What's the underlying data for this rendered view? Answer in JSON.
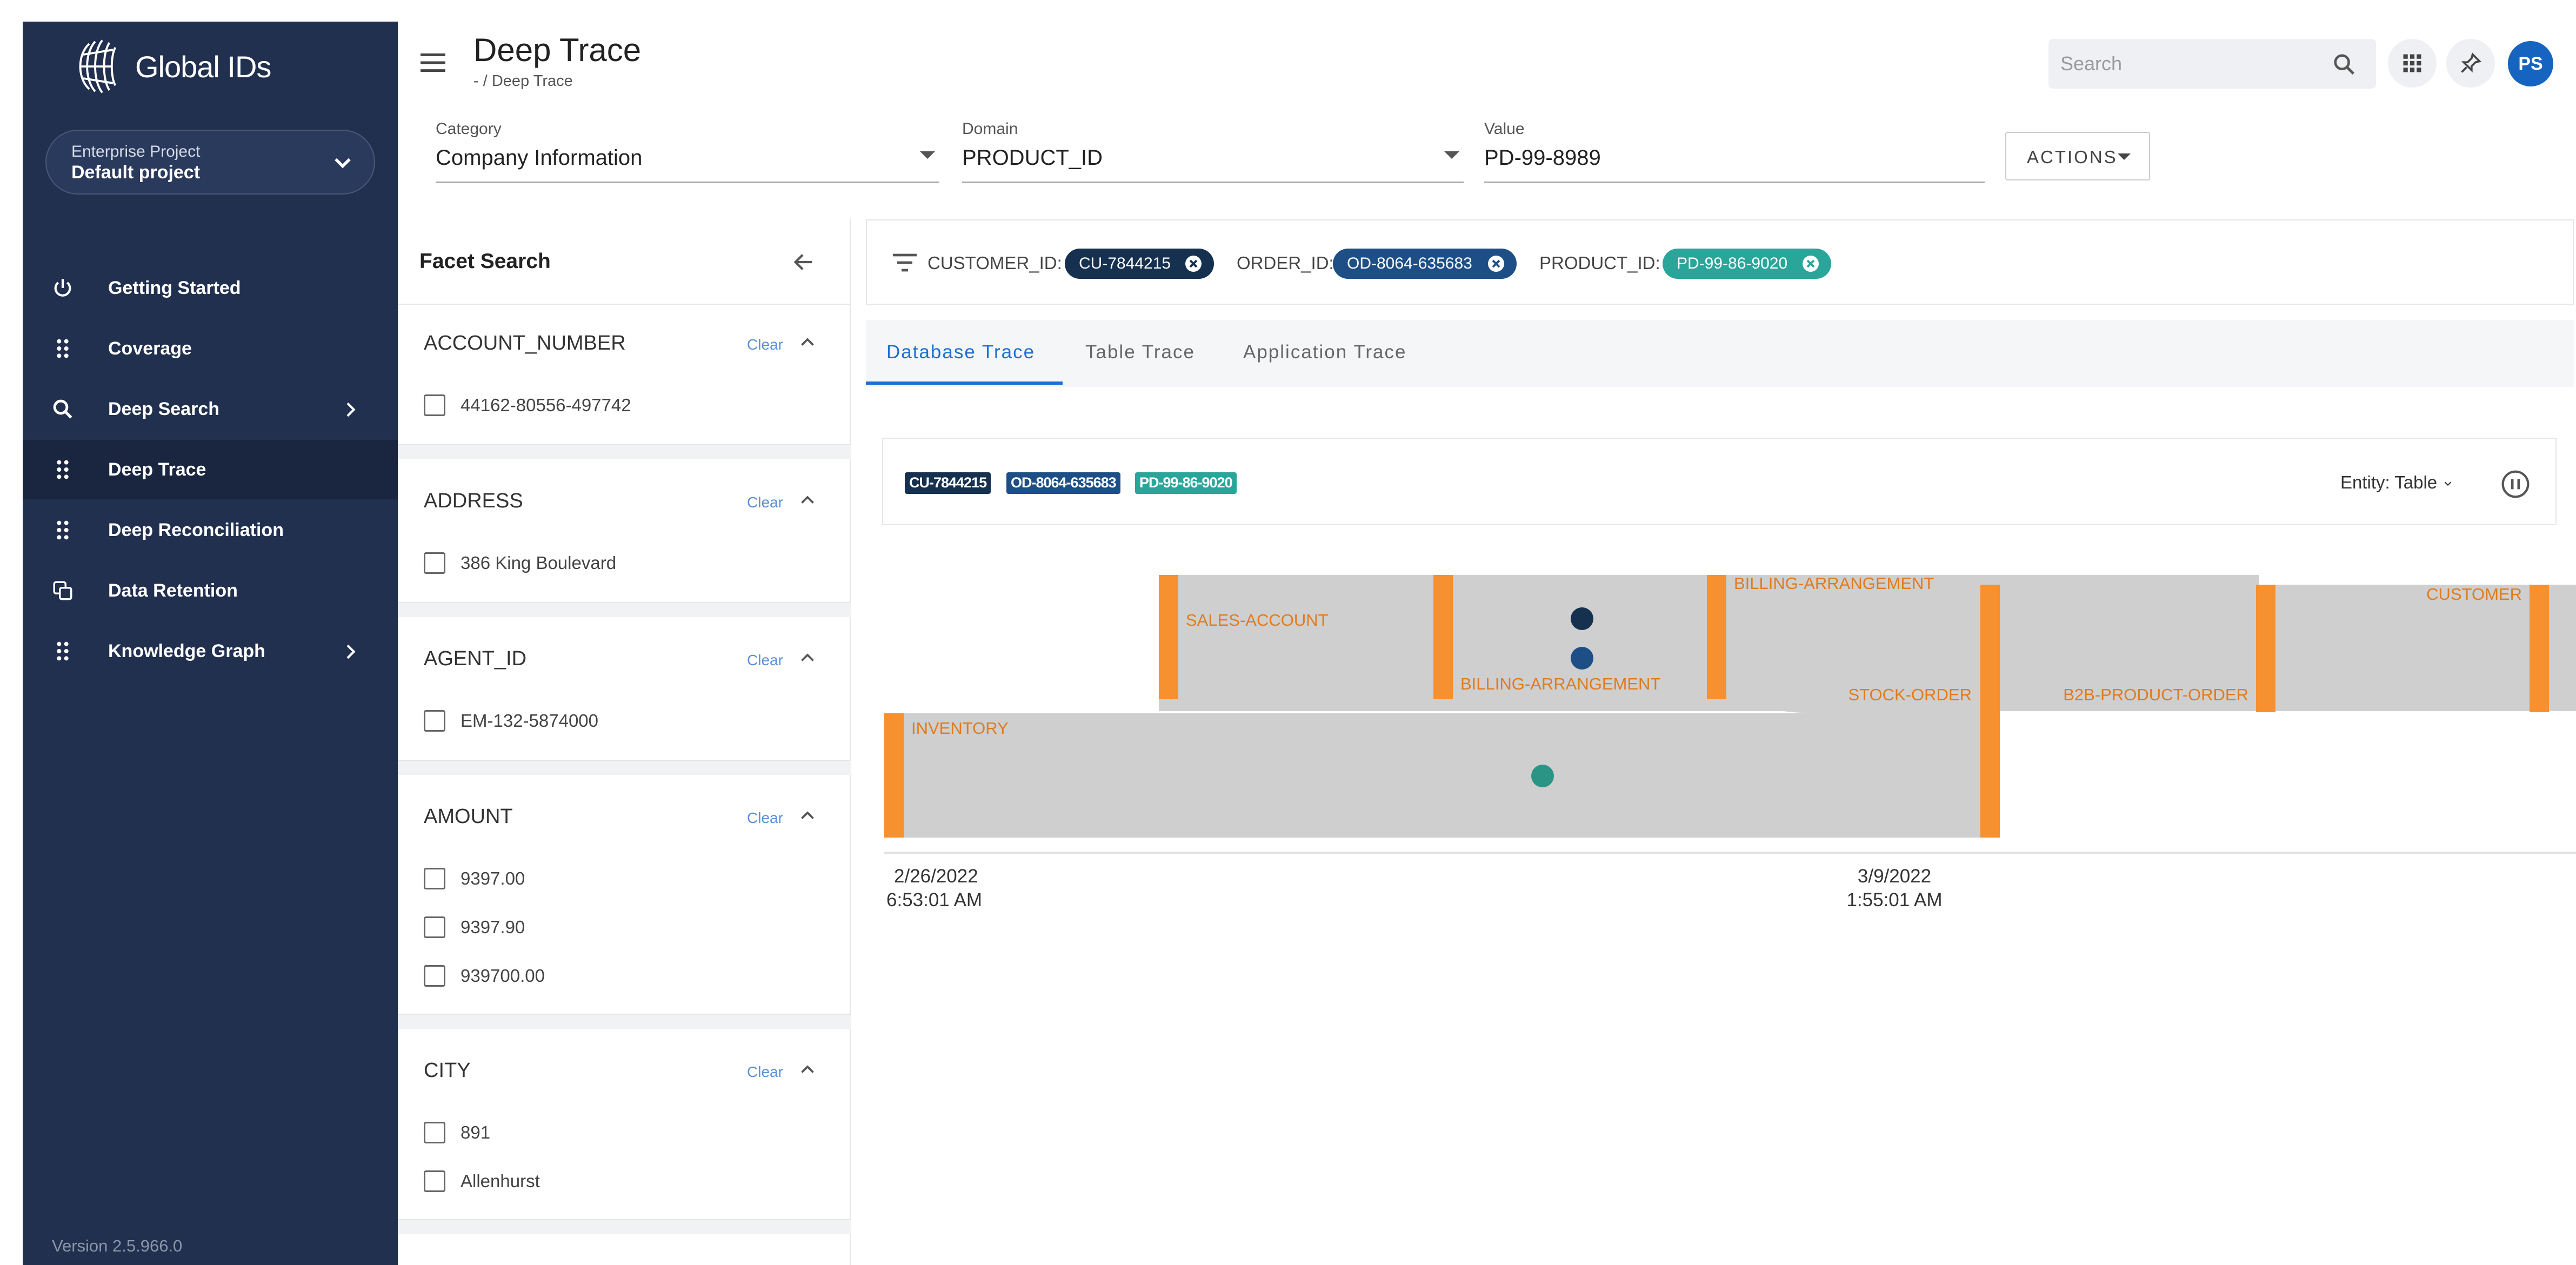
{
  "app": {
    "logo_text": "Global IDs",
    "version": "Version 2.5.966.0"
  },
  "project": {
    "label": "Enterprise Project",
    "value": "Default project"
  },
  "nav": {
    "items": [
      {
        "label": "Getting Started",
        "icon": "power-icon"
      },
      {
        "label": "Coverage",
        "icon": "grid-dots-icon"
      },
      {
        "label": "Deep Search",
        "icon": "search-icon"
      },
      {
        "label": "Deep Trace",
        "icon": "grid-dots-icon"
      },
      {
        "label": "Deep Reconciliation",
        "icon": "grid-dots-icon"
      },
      {
        "label": "Data Retention",
        "icon": "copy-icon"
      },
      {
        "label": "Knowledge Graph",
        "icon": "grid-dots-icon"
      }
    ],
    "active": "Deep Trace"
  },
  "header": {
    "title": "Deep Trace",
    "breadcrumb": "- / Deep Trace",
    "search_placeholder": "Search",
    "avatar_initials": "PS"
  },
  "filters": {
    "category": {
      "label": "Category",
      "value": "Company Information"
    },
    "domain": {
      "label": "Domain",
      "value": "PRODUCT_ID"
    },
    "value": {
      "label": "Value",
      "value": "PD-99-8989"
    },
    "actions_label": "ACTIONS"
  },
  "facets": {
    "title": "Facet Search",
    "clear_label": "Clear",
    "groups": [
      {
        "name": "ACCOUNT_NUMBER",
        "options": [
          "44162-80556-497742"
        ]
      },
      {
        "name": "ADDRESS",
        "options": [
          "386 King Boulevard"
        ]
      },
      {
        "name": "AGENT_ID",
        "options": [
          "EM-132-5874000"
        ]
      },
      {
        "name": "AMOUNT",
        "options": [
          "9397.00",
          "9397.90",
          "939700.00"
        ]
      },
      {
        "name": "CITY",
        "options": [
          "891",
          "Allenhurst"
        ]
      }
    ]
  },
  "chips": [
    {
      "key": "CUSTOMER_ID:",
      "value": "CU-7844215",
      "color": "#16304f"
    },
    {
      "key": "ORDER_ID:",
      "value": "OD-8064-635683",
      "color": "#1d4f86"
    },
    {
      "key": "PRODUCT_ID:",
      "value": "PD-99-86-9020",
      "color": "#2aa59a"
    }
  ],
  "tabs": [
    {
      "label": "Database Trace",
      "active": true
    },
    {
      "label": "Table Trace",
      "active": false
    },
    {
      "label": "Application Trace",
      "active": false
    }
  ],
  "trace": {
    "entity_label": "Entity: Table",
    "time_start": {
      "date": "2/26/2022",
      "time": "6:53:01 AM"
    },
    "time_mid": {
      "date": "3/9/2022",
      "time": "1:55:01 AM"
    },
    "colors": {
      "band": "#cfcfcf",
      "node": "#f7902f",
      "label": "#e07b1c",
      "dot_customer": "#16304f",
      "dot_order": "#1d4f86",
      "dot_product": "#2a9485"
    },
    "tables": [
      "SALES-ACCOUNT",
      "BILLING-ARRANGEMENT",
      "BILLING-ARRANGEMENT",
      "STOCK-ORDER",
      "B2B-PRODUCT-ORDER",
      "CUSTOMER",
      "INVENTORY"
    ]
  }
}
